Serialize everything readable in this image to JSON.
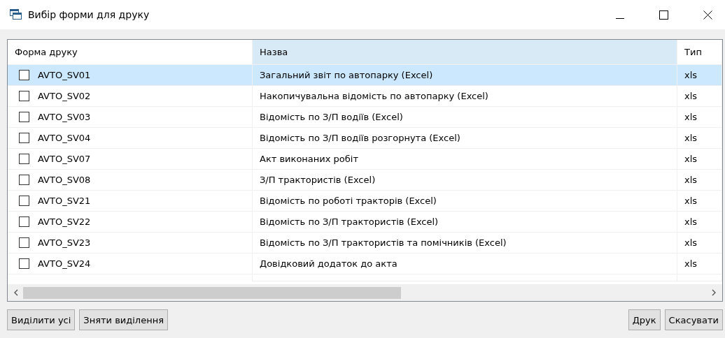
{
  "window": {
    "title": "Вибір форми для друку"
  },
  "table": {
    "columns": [
      {
        "label": "Форма друку",
        "selected": false
      },
      {
        "label": "Назва",
        "selected": true
      },
      {
        "label": "Тип",
        "selected": false
      }
    ],
    "rows": [
      {
        "code": "AVTO_SV01",
        "name": "Загальний звіт по автопарку (Excel)",
        "type": "xls",
        "checked": false,
        "selected": true
      },
      {
        "code": "AVTO_SV02",
        "name": "Накопичувальна відомість по автопарку (Excel)",
        "type": "xls",
        "checked": false,
        "selected": false
      },
      {
        "code": "AVTO_SV03",
        "name": "Відомість по З/П водіїв (Excel)",
        "type": "xls",
        "checked": false,
        "selected": false
      },
      {
        "code": "AVTO_SV04",
        "name": "Відомість по З/П водіїв розгорнута (Excel)",
        "type": "xls",
        "checked": false,
        "selected": false
      },
      {
        "code": "AVTO_SV07",
        "name": "Акт виконаних робіт",
        "type": "xls",
        "checked": false,
        "selected": false
      },
      {
        "code": "AVTO_SV08",
        "name": "З/П трактористів (Excel)",
        "type": "xls",
        "checked": false,
        "selected": false
      },
      {
        "code": "AVTO_SV21",
        "name": "Відомість по роботі тракторів (Excel)",
        "type": "xls",
        "checked": false,
        "selected": false
      },
      {
        "code": "AVTO_SV22",
        "name": "Відомість по З/П трактористів (Excel)",
        "type": "xls",
        "checked": false,
        "selected": false
      },
      {
        "code": "AVTO_SV23",
        "name": "Відомість по З/П трактористів та помічників (Excel)",
        "type": "xls",
        "checked": false,
        "selected": false
      },
      {
        "code": "AVTO_SV24",
        "name": "Довідковий додаток до акта",
        "type": "xls",
        "checked": false,
        "selected": false
      }
    ]
  },
  "buttons_left": [
    "Виділити усі",
    "Зняти виділення"
  ],
  "buttons_right": [
    "Друк",
    "Скасувати"
  ]
}
